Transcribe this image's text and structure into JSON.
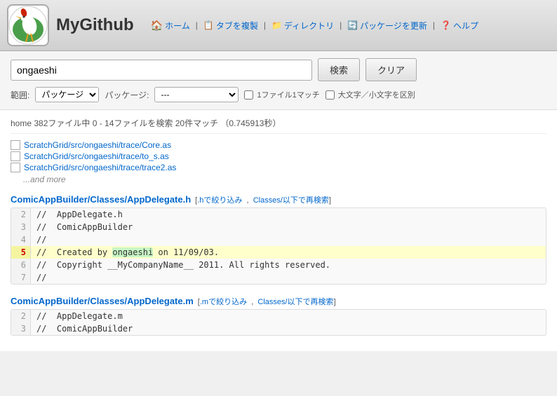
{
  "header": {
    "title": "MyGithub",
    "nav": {
      "home_label": "ホーム",
      "copy_tab_label": "タブを複製",
      "directory_label": "ディレクトリ",
      "update_pkg_label": "パッケージを更新",
      "help_label": "ヘルプ"
    }
  },
  "search": {
    "query": "ongaeshi",
    "search_button": "検索",
    "clear_button": "クリア",
    "scope_label": "範囲:",
    "scope_value": "パッケージ",
    "package_label": "パッケージ:",
    "package_value": "---",
    "one_file_match_label": "1ファイル1マッチ",
    "case_sensitive_label": "大文字／小文字を区別"
  },
  "results": {
    "summary": "home 382ファイル中 0 - 14ファイルを検索 20件マッチ （0.745913秒）",
    "files": [
      {
        "path": "ScratchGrid/src/ongaeshi/trace/Core.as"
      },
      {
        "path": "ScratchGrid/src/ongaeshi/trace/to_s.as"
      },
      {
        "path": "ScratchGrid/src/ongaeshi/trace/trace2.as"
      }
    ],
    "and_more": "...and more",
    "code_results": [
      {
        "file": "ComicAppBuilder/Classes/AppDelegate.h",
        "filter_text": "[.hで絞り込み , Classes/以下で再検索]",
        "filter_ext": ".hで絞り込み",
        "filter_dir": "Classes/以下で再検索",
        "lines": [
          {
            "num": 2,
            "content": "//  AppDelegate.h",
            "highlight": false
          },
          {
            "num": 3,
            "content": "//  ComicAppBuilder",
            "highlight": false
          },
          {
            "num": 4,
            "content": "//",
            "highlight": false
          },
          {
            "num": 5,
            "content": "//  Created by ongaeshi on 11/09/03.",
            "highlight": true,
            "highlight_start": 16,
            "highlight_end": 24
          },
          {
            "num": 6,
            "content": "//  Copyright __MyCompanyName__ 2011. All rights reserved.",
            "highlight": false
          },
          {
            "num": 7,
            "content": "//",
            "highlight": false
          }
        ]
      },
      {
        "file": "ComicAppBuilder/Classes/AppDelegate.m",
        "filter_text": "[.mで絞り込み , Classes/以下で再検索]",
        "filter_ext": ".mで絞り込み",
        "filter_dir": "Classes/以下で再検索",
        "lines": [
          {
            "num": 2,
            "content": "//  AppDelegate.m",
            "highlight": false
          },
          {
            "num": 3,
            "content": "//  ComicAppBuilder",
            "highlight": false
          }
        ]
      }
    ]
  }
}
